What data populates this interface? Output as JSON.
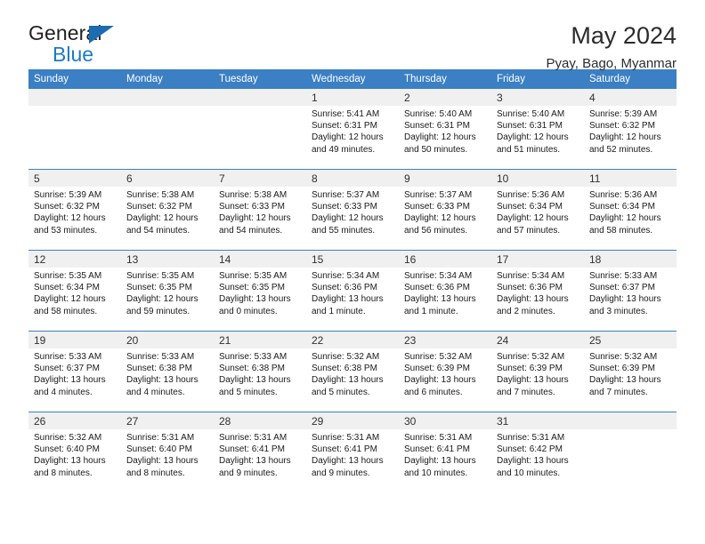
{
  "logo": {
    "primary": "General",
    "secondary": "Blue",
    "triangle_color": "#1b6cb0"
  },
  "header": {
    "title": "May 2024",
    "subtitle": "Pyay, Bago, Myanmar"
  },
  "theme": {
    "header_band": "#3b7fc4",
    "daynum_band": "#f0f0f0",
    "text": "#1a1a1a"
  },
  "calendar": {
    "weekday_headers": [
      "Sunday",
      "Monday",
      "Tuesday",
      "Wednesday",
      "Thursday",
      "Friday",
      "Saturday"
    ],
    "weeks": [
      [
        {
          "day": "",
          "sunrise": "",
          "sunset": "",
          "daylight_line1": "",
          "daylight_line2": ""
        },
        {
          "day": "",
          "sunrise": "",
          "sunset": "",
          "daylight_line1": "",
          "daylight_line2": ""
        },
        {
          "day": "",
          "sunrise": "",
          "sunset": "",
          "daylight_line1": "",
          "daylight_line2": ""
        },
        {
          "day": "1",
          "sunrise": "Sunrise: 5:41 AM",
          "sunset": "Sunset: 6:31 PM",
          "daylight_line1": "Daylight: 12 hours",
          "daylight_line2": "and 49 minutes."
        },
        {
          "day": "2",
          "sunrise": "Sunrise: 5:40 AM",
          "sunset": "Sunset: 6:31 PM",
          "daylight_line1": "Daylight: 12 hours",
          "daylight_line2": "and 50 minutes."
        },
        {
          "day": "3",
          "sunrise": "Sunrise: 5:40 AM",
          "sunset": "Sunset: 6:31 PM",
          "daylight_line1": "Daylight: 12 hours",
          "daylight_line2": "and 51 minutes."
        },
        {
          "day": "4",
          "sunrise": "Sunrise: 5:39 AM",
          "sunset": "Sunset: 6:32 PM",
          "daylight_line1": "Daylight: 12 hours",
          "daylight_line2": "and 52 minutes."
        }
      ],
      [
        {
          "day": "5",
          "sunrise": "Sunrise: 5:39 AM",
          "sunset": "Sunset: 6:32 PM",
          "daylight_line1": "Daylight: 12 hours",
          "daylight_line2": "and 53 minutes."
        },
        {
          "day": "6",
          "sunrise": "Sunrise: 5:38 AM",
          "sunset": "Sunset: 6:32 PM",
          "daylight_line1": "Daylight: 12 hours",
          "daylight_line2": "and 54 minutes."
        },
        {
          "day": "7",
          "sunrise": "Sunrise: 5:38 AM",
          "sunset": "Sunset: 6:33 PM",
          "daylight_line1": "Daylight: 12 hours",
          "daylight_line2": "and 54 minutes."
        },
        {
          "day": "8",
          "sunrise": "Sunrise: 5:37 AM",
          "sunset": "Sunset: 6:33 PM",
          "daylight_line1": "Daylight: 12 hours",
          "daylight_line2": "and 55 minutes."
        },
        {
          "day": "9",
          "sunrise": "Sunrise: 5:37 AM",
          "sunset": "Sunset: 6:33 PM",
          "daylight_line1": "Daylight: 12 hours",
          "daylight_line2": "and 56 minutes."
        },
        {
          "day": "10",
          "sunrise": "Sunrise: 5:36 AM",
          "sunset": "Sunset: 6:34 PM",
          "daylight_line1": "Daylight: 12 hours",
          "daylight_line2": "and 57 minutes."
        },
        {
          "day": "11",
          "sunrise": "Sunrise: 5:36 AM",
          "sunset": "Sunset: 6:34 PM",
          "daylight_line1": "Daylight: 12 hours",
          "daylight_line2": "and 58 minutes."
        }
      ],
      [
        {
          "day": "12",
          "sunrise": "Sunrise: 5:35 AM",
          "sunset": "Sunset: 6:34 PM",
          "daylight_line1": "Daylight: 12 hours",
          "daylight_line2": "and 58 minutes."
        },
        {
          "day": "13",
          "sunrise": "Sunrise: 5:35 AM",
          "sunset": "Sunset: 6:35 PM",
          "daylight_line1": "Daylight: 12 hours",
          "daylight_line2": "and 59 minutes."
        },
        {
          "day": "14",
          "sunrise": "Sunrise: 5:35 AM",
          "sunset": "Sunset: 6:35 PM",
          "daylight_line1": "Daylight: 13 hours",
          "daylight_line2": "and 0 minutes."
        },
        {
          "day": "15",
          "sunrise": "Sunrise: 5:34 AM",
          "sunset": "Sunset: 6:36 PM",
          "daylight_line1": "Daylight: 13 hours",
          "daylight_line2": "and 1 minute."
        },
        {
          "day": "16",
          "sunrise": "Sunrise: 5:34 AM",
          "sunset": "Sunset: 6:36 PM",
          "daylight_line1": "Daylight: 13 hours",
          "daylight_line2": "and 1 minute."
        },
        {
          "day": "17",
          "sunrise": "Sunrise: 5:34 AM",
          "sunset": "Sunset: 6:36 PM",
          "daylight_line1": "Daylight: 13 hours",
          "daylight_line2": "and 2 minutes."
        },
        {
          "day": "18",
          "sunrise": "Sunrise: 5:33 AM",
          "sunset": "Sunset: 6:37 PM",
          "daylight_line1": "Daylight: 13 hours",
          "daylight_line2": "and 3 minutes."
        }
      ],
      [
        {
          "day": "19",
          "sunrise": "Sunrise: 5:33 AM",
          "sunset": "Sunset: 6:37 PM",
          "daylight_line1": "Daylight: 13 hours",
          "daylight_line2": "and 4 minutes."
        },
        {
          "day": "20",
          "sunrise": "Sunrise: 5:33 AM",
          "sunset": "Sunset: 6:38 PM",
          "daylight_line1": "Daylight: 13 hours",
          "daylight_line2": "and 4 minutes."
        },
        {
          "day": "21",
          "sunrise": "Sunrise: 5:33 AM",
          "sunset": "Sunset: 6:38 PM",
          "daylight_line1": "Daylight: 13 hours",
          "daylight_line2": "and 5 minutes."
        },
        {
          "day": "22",
          "sunrise": "Sunrise: 5:32 AM",
          "sunset": "Sunset: 6:38 PM",
          "daylight_line1": "Daylight: 13 hours",
          "daylight_line2": "and 5 minutes."
        },
        {
          "day": "23",
          "sunrise": "Sunrise: 5:32 AM",
          "sunset": "Sunset: 6:39 PM",
          "daylight_line1": "Daylight: 13 hours",
          "daylight_line2": "and 6 minutes."
        },
        {
          "day": "24",
          "sunrise": "Sunrise: 5:32 AM",
          "sunset": "Sunset: 6:39 PM",
          "daylight_line1": "Daylight: 13 hours",
          "daylight_line2": "and 7 minutes."
        },
        {
          "day": "25",
          "sunrise": "Sunrise: 5:32 AM",
          "sunset": "Sunset: 6:39 PM",
          "daylight_line1": "Daylight: 13 hours",
          "daylight_line2": "and 7 minutes."
        }
      ],
      [
        {
          "day": "26",
          "sunrise": "Sunrise: 5:32 AM",
          "sunset": "Sunset: 6:40 PM",
          "daylight_line1": "Daylight: 13 hours",
          "daylight_line2": "and 8 minutes."
        },
        {
          "day": "27",
          "sunrise": "Sunrise: 5:31 AM",
          "sunset": "Sunset: 6:40 PM",
          "daylight_line1": "Daylight: 13 hours",
          "daylight_line2": "and 8 minutes."
        },
        {
          "day": "28",
          "sunrise": "Sunrise: 5:31 AM",
          "sunset": "Sunset: 6:41 PM",
          "daylight_line1": "Daylight: 13 hours",
          "daylight_line2": "and 9 minutes."
        },
        {
          "day": "29",
          "sunrise": "Sunrise: 5:31 AM",
          "sunset": "Sunset: 6:41 PM",
          "daylight_line1": "Daylight: 13 hours",
          "daylight_line2": "and 9 minutes."
        },
        {
          "day": "30",
          "sunrise": "Sunrise: 5:31 AM",
          "sunset": "Sunset: 6:41 PM",
          "daylight_line1": "Daylight: 13 hours",
          "daylight_line2": "and 10 minutes."
        },
        {
          "day": "31",
          "sunrise": "Sunrise: 5:31 AM",
          "sunset": "Sunset: 6:42 PM",
          "daylight_line1": "Daylight: 13 hours",
          "daylight_line2": "and 10 minutes."
        },
        {
          "day": "",
          "sunrise": "",
          "sunset": "",
          "daylight_line1": "",
          "daylight_line2": ""
        }
      ]
    ]
  }
}
